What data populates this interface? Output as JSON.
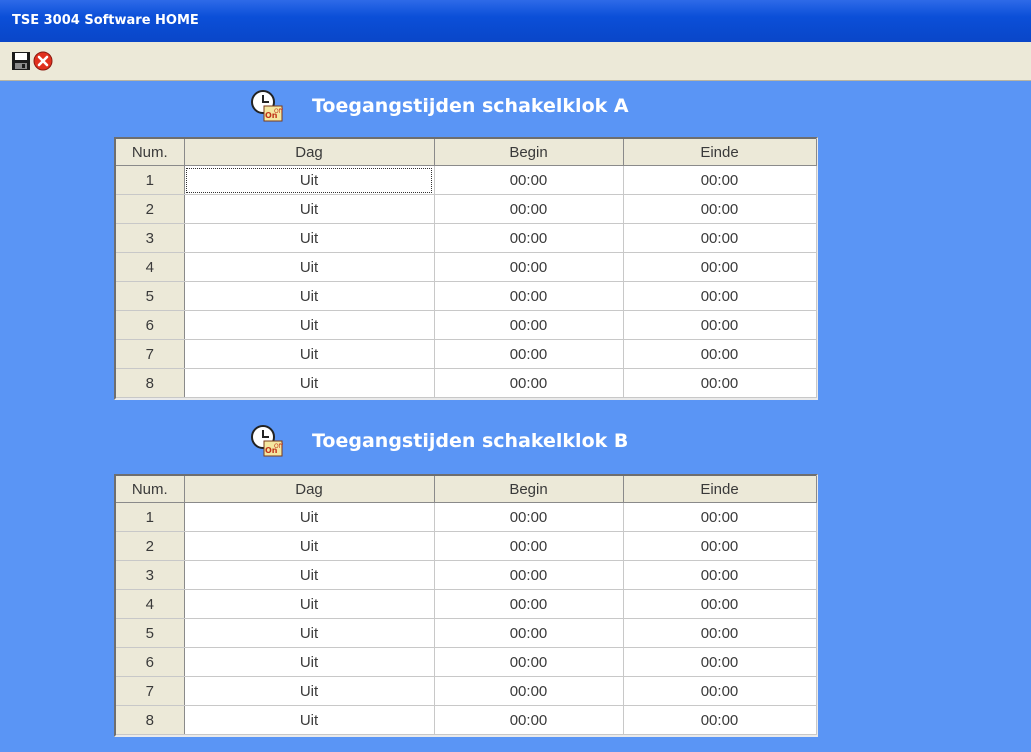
{
  "window": {
    "title": "TSE 3004 Software HOME"
  },
  "toolbar": {
    "save_icon": "floppy-disk-icon",
    "close_icon": "red-circle-x-icon"
  },
  "sections": [
    {
      "title": "Toegangstijden schakelklok A",
      "icon": "clock-on-off-icon",
      "columns": [
        "Num.",
        "Dag",
        "Begin",
        "Einde"
      ],
      "rows": [
        {
          "num": "1",
          "dag": "Uit",
          "begin": "00:00",
          "einde": "00:00"
        },
        {
          "num": "2",
          "dag": "Uit",
          "begin": "00:00",
          "einde": "00:00"
        },
        {
          "num": "3",
          "dag": "Uit",
          "begin": "00:00",
          "einde": "00:00"
        },
        {
          "num": "4",
          "dag": "Uit",
          "begin": "00:00",
          "einde": "00:00"
        },
        {
          "num": "5",
          "dag": "Uit",
          "begin": "00:00",
          "einde": "00:00"
        },
        {
          "num": "6",
          "dag": "Uit",
          "begin": "00:00",
          "einde": "00:00"
        },
        {
          "num": "7",
          "dag": "Uit",
          "begin": "00:00",
          "einde": "00:00"
        },
        {
          "num": "8",
          "dag": "Uit",
          "begin": "00:00",
          "einde": "00:00"
        }
      ]
    },
    {
      "title": "Toegangstijden schakelklok B",
      "icon": "clock-on-off-icon",
      "columns": [
        "Num.",
        "Dag",
        "Begin",
        "Einde"
      ],
      "rows": [
        {
          "num": "1",
          "dag": "Uit",
          "begin": "00:00",
          "einde": "00:00"
        },
        {
          "num": "2",
          "dag": "Uit",
          "begin": "00:00",
          "einde": "00:00"
        },
        {
          "num": "3",
          "dag": "Uit",
          "begin": "00:00",
          "einde": "00:00"
        },
        {
          "num": "4",
          "dag": "Uit",
          "begin": "00:00",
          "einde": "00:00"
        },
        {
          "num": "5",
          "dag": "Uit",
          "begin": "00:00",
          "einde": "00:00"
        },
        {
          "num": "6",
          "dag": "Uit",
          "begin": "00:00",
          "einde": "00:00"
        },
        {
          "num": "7",
          "dag": "Uit",
          "begin": "00:00",
          "einde": "00:00"
        },
        {
          "num": "8",
          "dag": "Uit",
          "begin": "00:00",
          "einde": "00:00"
        }
      ]
    }
  ]
}
